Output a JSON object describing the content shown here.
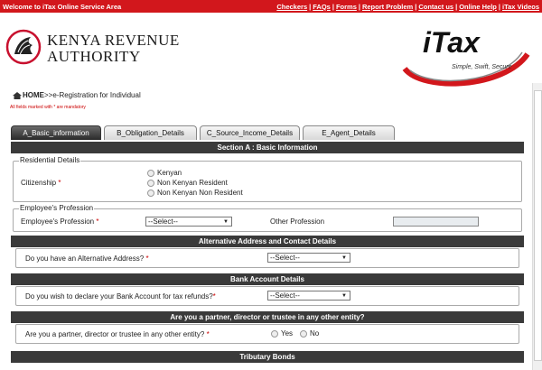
{
  "topbar": {
    "welcome": "Welcome to iTax Online Service Area",
    "links": [
      "Checkers",
      "FAQs",
      "Forms",
      "Report Problem",
      "Contact us",
      "Online Help",
      "iTax Videos"
    ]
  },
  "header": {
    "kra_line1": "Kenya Revenue",
    "kra_line2": "Authority",
    "itax_brand": "iTax",
    "itax_tagline": "Simple, Swift, Secure"
  },
  "breadcrumb": {
    "home": "HOME",
    "path": ">>e-Registration for Individual"
  },
  "mandatory_note": "All fields marked with * are mandatory",
  "tabs": [
    {
      "label": "A_Basic_information",
      "active": true
    },
    {
      "label": "B_Obligation_Details",
      "active": false
    },
    {
      "label": "C_Source_Income_Details",
      "active": false
    },
    {
      "label": "E_Agent_Details",
      "active": false
    }
  ],
  "section_a": "Section A : Basic Information",
  "residential": {
    "legend": "Residential Details",
    "label": "Citizenship",
    "options": [
      "Kenyan",
      "Non Kenyan Resident",
      "Non Kenyan Non Resident"
    ]
  },
  "profession": {
    "legend": "Employee's Profession",
    "label": "Employee's Profession",
    "select_value": "--Select--",
    "other_label": "Other Profession",
    "other_value": ""
  },
  "alt_address": {
    "title": "Alternative Address and Contact Details",
    "question": "Do you have an Alternative Address?",
    "select_value": "--Select--"
  },
  "bank": {
    "title": "Bank Account Details",
    "question": "Do you wish to declare your Bank Account for tax refunds?",
    "select_value": "--Select--"
  },
  "partner": {
    "title": "Are you a partner, director or trustee in any other entity?",
    "question": "Are you a partner, director or trustee in any other entity?",
    "yes": "Yes",
    "no": "No"
  },
  "tributary": {
    "title": "Tributary Bonds"
  },
  "required_mark": "*"
}
